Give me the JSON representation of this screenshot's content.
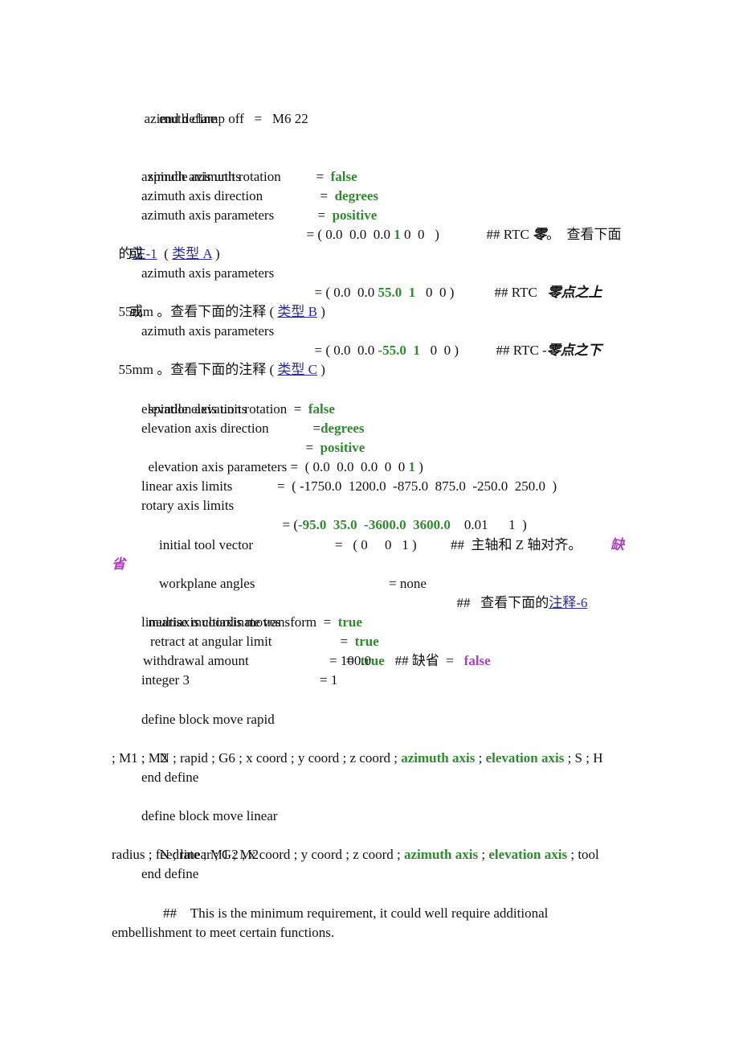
{
  "lines": {
    "clamp_off": {
      "label": "azimuth clamp off",
      "eq": "=",
      "value": "M6 22"
    },
    "end_define_1": "end define",
    "spindle_az_rot": {
      "label": "spindle azimuth rotation",
      "eq": "=",
      "value": "false"
    },
    "az_units": {
      "label": "azimuth axis units",
      "eq": "=",
      "value": "degrees"
    },
    "az_dir": {
      "label": "azimuth axis direction",
      "eq": "=",
      "value": "positive"
    },
    "az_params_a": {
      "label": "azimuth axis parameters",
      "prefix": "= ( 0.0  0.0  0.0 ",
      "hl": "1",
      "suffix": " 0  0   )",
      "comment": "## RTC ",
      "comment_it": "零",
      "comment_tail": "。  查看下面",
      "wrap_pre": "的",
      "link1": "注-1",
      "wrap_mid": "  ( ",
      "link2": "类型 A",
      "wrap_end": " )"
    },
    "or_1": "或",
    "az_params_b": {
      "label": "azimuth axis parameters",
      "prefix": "= ( 0.0  0.0 ",
      "hl": "55.0  1",
      "suffix": "   0  0 )",
      "comment": "## RTC   ",
      "comment_it": "零点之上",
      "wrap_pre": "55mm 。查看下面的注释 ( ",
      "link": "类型 B",
      "wrap_end": " )"
    },
    "or_2": "或",
    "az_params_c": {
      "label": "azimuth axis parameters",
      "prefix": "= ( 0.0  0.0 ",
      "hl": "-55.0  1",
      "suffix": "   0  0 )",
      "comment": "## RTC -",
      "comment_it": "零点之下",
      "wrap_pre": "55mm 。查看下面的注释 ( ",
      "link": "类型 C",
      "wrap_end": " )"
    },
    "spindle_el_rot": {
      "label": "spindle elevation rotation",
      "eq": "=",
      "value": "false"
    },
    "el_units": {
      "label": "elevation axis units",
      "eq": "=",
      "value": "degrees"
    },
    "el_dir": {
      "label": "elevation axis direction",
      "eq": "=",
      "value": "positive"
    },
    "el_params": {
      "label": "elevation axis parameters",
      "prefix": "=  ( 0.0  0.0  0.0  0  0 ",
      "hl": "1",
      "suffix": " )"
    },
    "linear_limits": {
      "label": "linear axis limits",
      "value": "=  ( -1750.0  1200.0  -875.0  875.0  -250.0  250.0  )"
    },
    "rotary_limits": {
      "label": "rotary axis limits",
      "prefix": "= (",
      "hl": "-95.0  35.0  -3600.0  3600.0",
      "suffix": "    0.01      1  )"
    },
    "init_tool_vec": {
      "label": "initial tool vector",
      "value": "=   ( 0     0   1 )",
      "comment": "##  主轴和 Z 轴对齐。",
      "default_label": "缺",
      "wrap": "省"
    },
    "workplane": {
      "label": "workplane angles",
      "value": "= none",
      "comment": "##   查看下面的",
      "link": "注释-6"
    },
    "multiaxis_ct": {
      "label": "multiaxis coordinate transform",
      "eq": "=",
      "value": "true"
    },
    "linearise": {
      "label": "linearise multiaxis moves",
      "eq": "=",
      "value": "true"
    },
    "retract": {
      "label": "retract at angular limit",
      "eq": "=",
      "value": "true",
      "comment": "## 缺省  =",
      "default_value": "false"
    },
    "withdrawal": {
      "label": "withdrawal amount",
      "value": "= 100.0"
    },
    "integer3": {
      "label": "integer 3",
      "value": "= 1"
    },
    "def_rapid": "define block move rapid",
    "rapid_body": {
      "pre": "N ; rapid ; G6 ; x coord ; y coord ; z coord ; ",
      "hl1": "azimuth axis",
      "sep": " ; ",
      "hl2": "elevation axis",
      "post": " ; S ; H",
      "wrap": "; M1 ; M2"
    },
    "end_define_2": "end define",
    "def_linear": "define block move linear",
    "linear_body": {
      "pre": "N ; linear ; G2 ; x coord ; y coord ; z coord ; ",
      "hl1": "azimuth axis",
      "sep": " ; ",
      "hl2": "elevation axis",
      "post": " ; tool",
      "wrap": "radius ; feedrate ; M1 ; M2"
    },
    "end_define_3": "end define",
    "note": {
      "text": "##    This is the minimum requirement, it could well require additional",
      "wrap": "embellishment to meet certain functions."
    }
  }
}
